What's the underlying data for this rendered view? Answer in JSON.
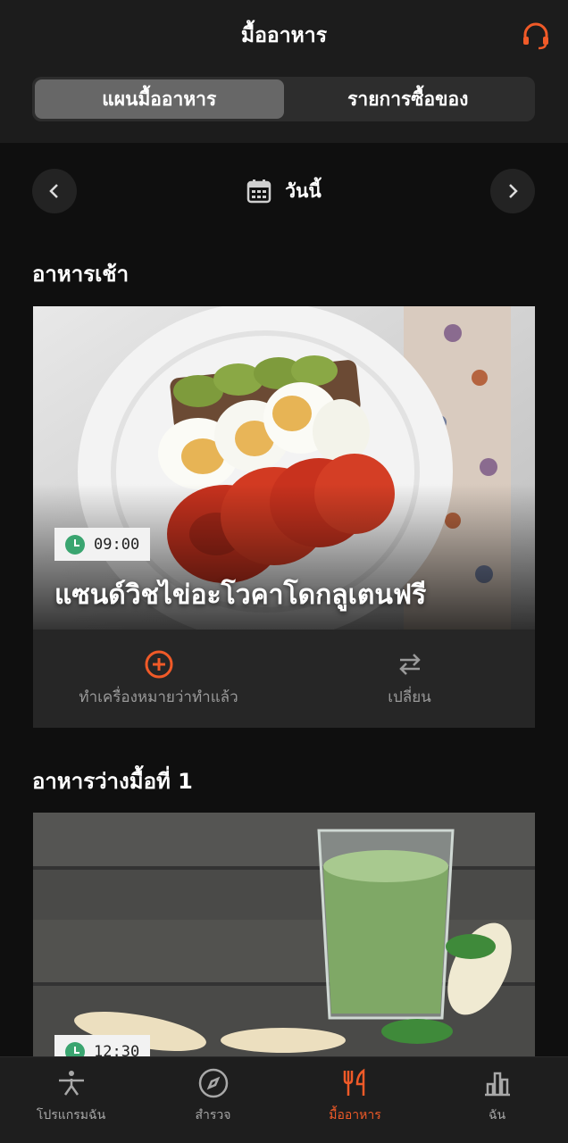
{
  "header": {
    "title": "มื้ออาหาร",
    "support_icon": "headset-icon",
    "segments": [
      {
        "label": "แผนมื้ออาหาร",
        "active": true
      },
      {
        "label": "รายการซื้อของ",
        "active": false
      }
    ]
  },
  "datebar": {
    "label": "วันนี้",
    "icon": "calendar-icon"
  },
  "meals": [
    {
      "section": "อาหารเช้า",
      "time": "09:00",
      "name": "แซนด์วิชไข่อะโวคาโดกลูเตนฟรี",
      "actions": [
        {
          "label": "ทำเครื่องหมายว่าทำแล้ว",
          "icon": "plus-circle-icon"
        },
        {
          "label": "เปลี่ยน",
          "icon": "swap-icon"
        }
      ]
    },
    {
      "section": "อาหารว่างมื้อที่ 1",
      "time": "12:30"
    }
  ],
  "tabbar": [
    {
      "label": "โปรแกรมฉัน",
      "icon": "exercise-icon",
      "active": false
    },
    {
      "label": "สำรวจ",
      "icon": "compass-icon",
      "active": false
    },
    {
      "label": "มื้ออาหาร",
      "icon": "utensils-icon",
      "active": true
    },
    {
      "label": "ฉัน",
      "icon": "bar-chart-icon",
      "active": false
    }
  ],
  "colors": {
    "accent": "#f05a28",
    "clock": "#3aa570",
    "background": "#0f0f0f"
  }
}
